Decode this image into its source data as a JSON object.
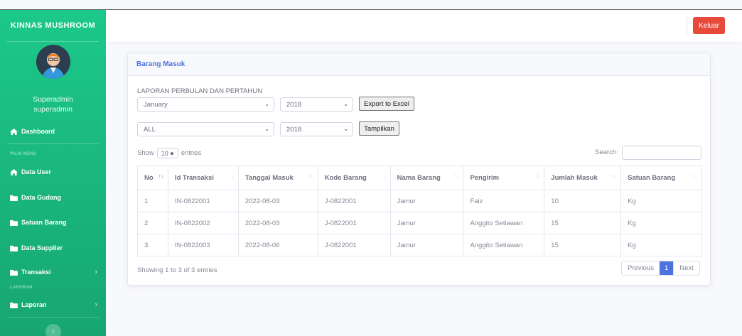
{
  "app": {
    "brand": "KINNAS MUSHROOM",
    "logout_label": "Keluar"
  },
  "user": {
    "display_name": "Superadmin",
    "username": "superadmin"
  },
  "sidebar": {
    "items": [
      {
        "label": "Dashboard",
        "icon": "home-icon"
      },
      {
        "label": "Data User",
        "icon": "home-icon"
      },
      {
        "label": "Data Gudang",
        "icon": "folder-icon"
      },
      {
        "label": "Satuan Barang",
        "icon": "folder-icon"
      },
      {
        "label": "Data Supplier",
        "icon": "folder-icon"
      },
      {
        "label": "Transaksi",
        "icon": "folder-icon"
      },
      {
        "label": "Laporan",
        "icon": "folder-icon"
      }
    ],
    "headings": [
      "PILIH MENU",
      "LAPORAN"
    ]
  },
  "card": {
    "title": "Barang Masuk",
    "report_label": "LAPORAN PERBULAN DAN PERTAHUN",
    "month_select": "January",
    "year_select_1": "2018",
    "export_label": "Export to Excel",
    "filter_select": "ALL",
    "year_select_2": "2018",
    "show_label": "Tampilkan"
  },
  "table": {
    "show_prefix": "Show",
    "entries_value": "10",
    "show_suffix": "entries",
    "search_label": "Search:",
    "columns": [
      "No",
      "Id Transaksi",
      "Tanggal Masuk",
      "Kode Barang",
      "Nama Barang",
      "Pengirim",
      "Jumlah Masuk",
      "Satuan Barang"
    ],
    "rows": [
      [
        "1",
        "IN-0822001",
        "2022-08-03",
        "J-0822001",
        "Jamur",
        "Faiz",
        "10",
        "Kg"
      ],
      [
        "2",
        "IN-0822002",
        "2022-08-03",
        "J-0822001",
        "Jamur",
        "Anggito Setiawan",
        "15",
        "Kg"
      ],
      [
        "3",
        "IN-0822003",
        "2022-08-06",
        "J-0822001",
        "Jamur",
        "Anggito Setiawan",
        "15",
        "Kg"
      ]
    ],
    "info": "Showing 1 to 3 of 3 entries",
    "pager": {
      "prev": "Previous",
      "current": "1",
      "next": "Next"
    }
  },
  "colors": {
    "sidebar": "#1cc88a",
    "primary": "#4e73df",
    "danger": "#e74a3b"
  }
}
